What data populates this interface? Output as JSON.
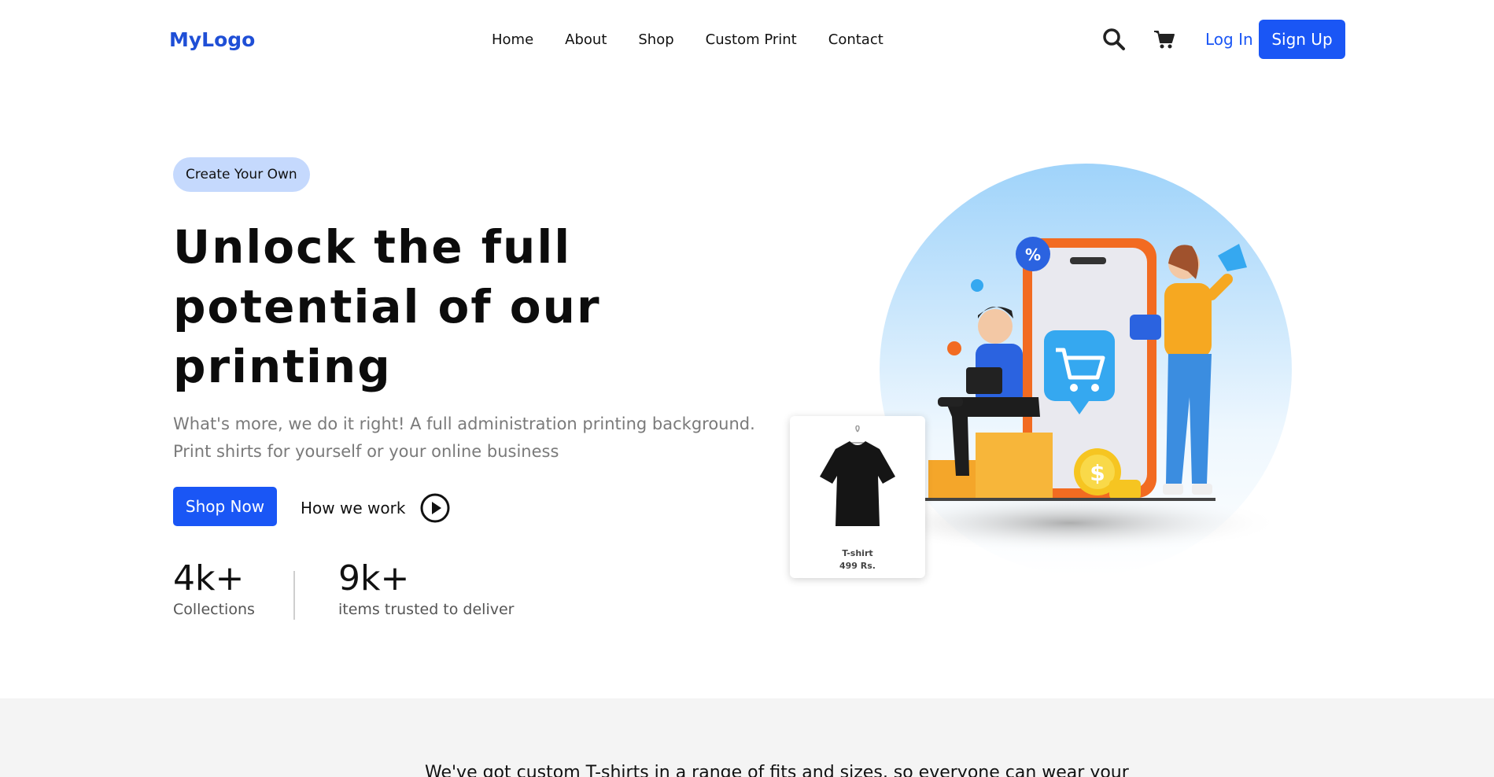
{
  "nav": {
    "logo": "MyLogo",
    "items": [
      {
        "label": "Home"
      },
      {
        "label": "About"
      },
      {
        "label": "Shop"
      },
      {
        "label": "Custom Print"
      },
      {
        "label": "Contact"
      }
    ],
    "search_icon": "search-icon",
    "cart_icon": "cart-icon",
    "login_label": "Log In",
    "signup_label": "Sign Up"
  },
  "hero": {
    "badge": "Create Your Own",
    "headline": "Unlock the full potential of our printing",
    "subtext_line1": "What's more, we do it right! A full administration printing background.",
    "subtext_line2": "Print shirts for yourself or your online business",
    "shop_now_label": "Shop Now",
    "how_we_work_label": "How we work",
    "stats": [
      {
        "value": "4k+",
        "label": "Collections"
      },
      {
        "value": "9k+",
        "label": "items trusted to deliver"
      }
    ],
    "product_card": {
      "name": "T-shirt",
      "price": "499 Rs."
    }
  },
  "section2": {
    "text": "We've got custom T-shirts in a range of fits and sizes, so everyone can wear your"
  },
  "colors": {
    "brand": "#1a56f5",
    "logo": "#1f4fd6",
    "badge_bg": "#c5d9fd",
    "band_bg": "#f4f4f4"
  }
}
